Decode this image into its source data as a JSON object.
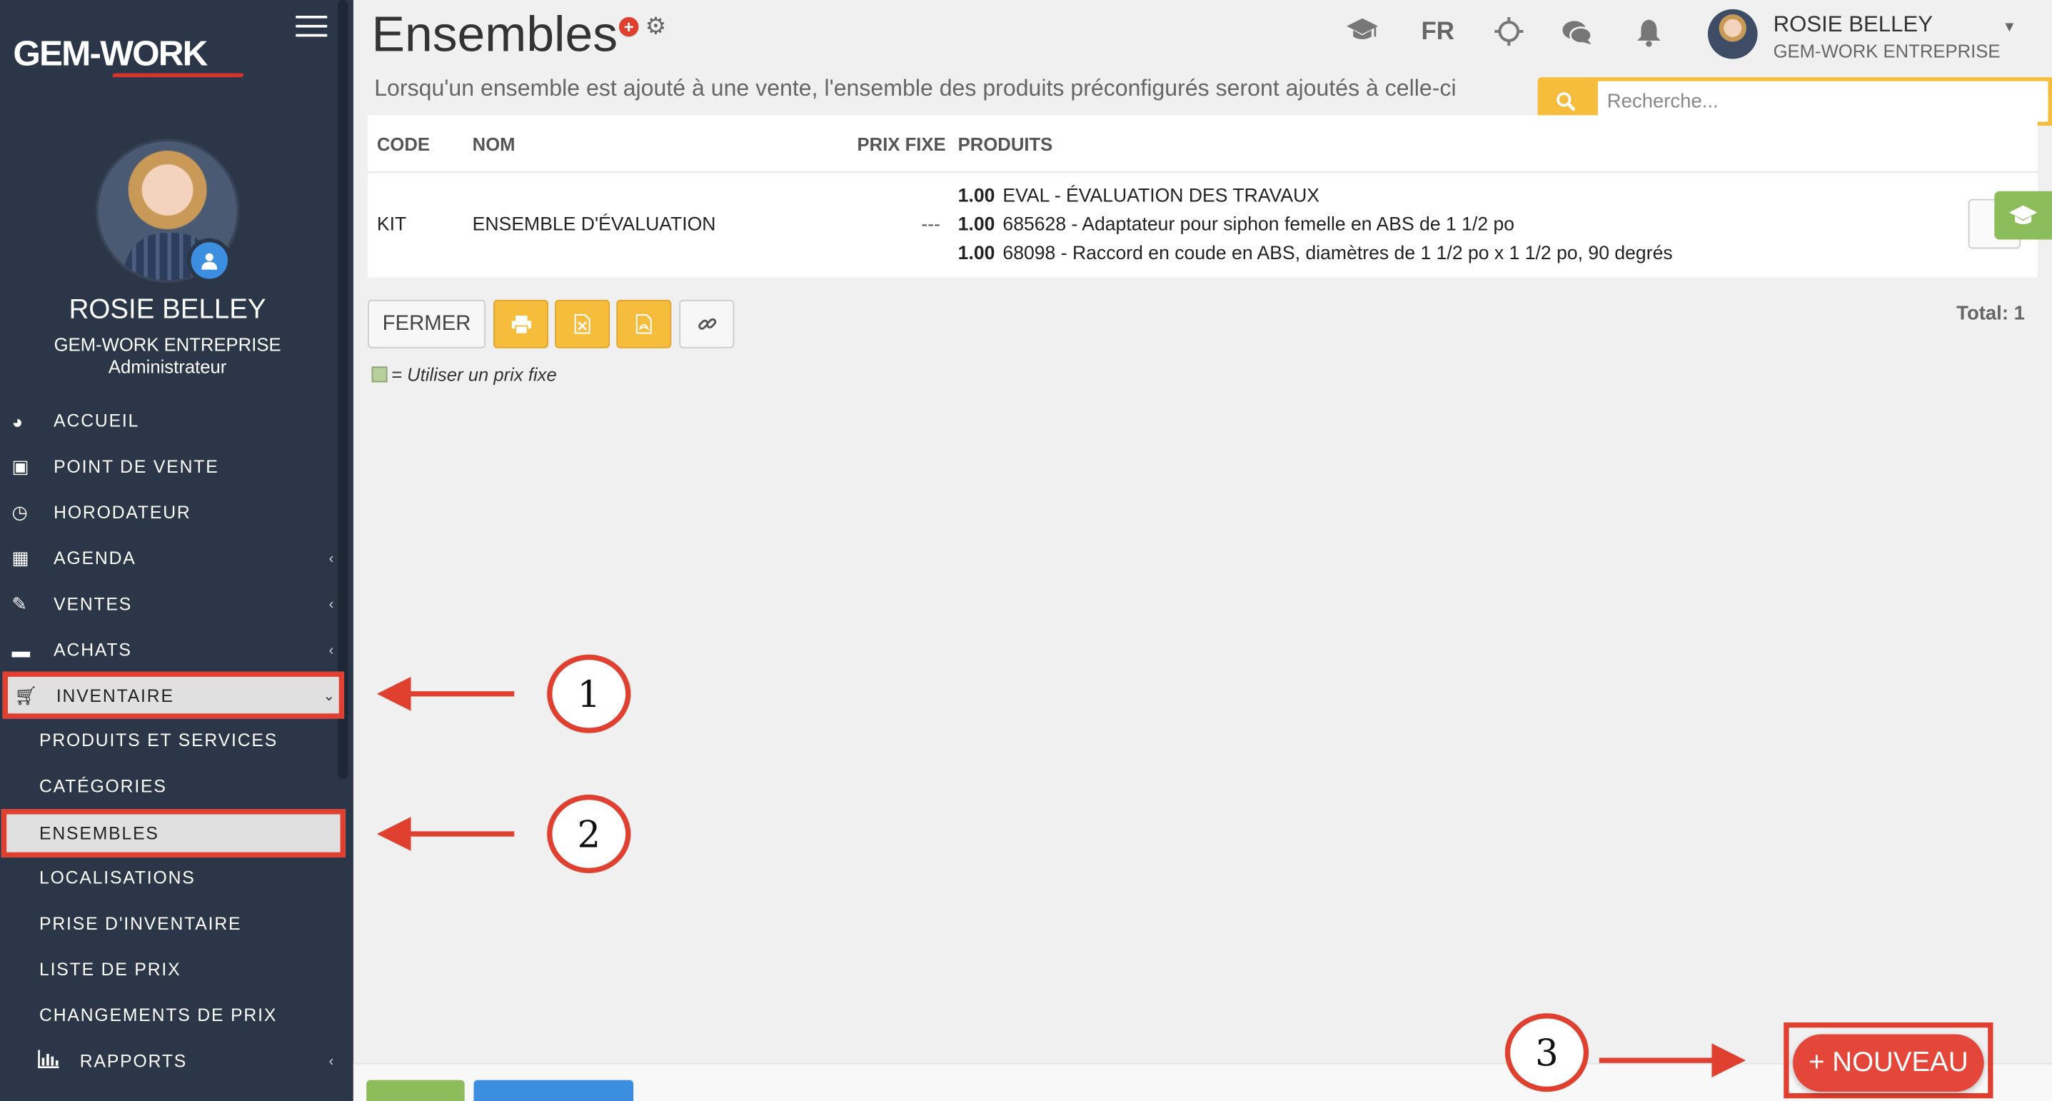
{
  "app": {
    "logo": "GEM-WORK"
  },
  "sidebar": {
    "user_name": "ROSIE BELLEY",
    "company": "GEM-WORK ENTREPRISE",
    "role": "Administrateur",
    "items": [
      {
        "label": "ACCUEIL",
        "icon": "dashboard-icon"
      },
      {
        "label": "POINT DE VENTE",
        "icon": "cash-icon"
      },
      {
        "label": "HORODATEUR",
        "icon": "clock-icon"
      },
      {
        "label": "AGENDA",
        "icon": "calendar-icon"
      },
      {
        "label": "VENTES",
        "icon": "edit-icon"
      },
      {
        "label": "ACHATS",
        "icon": "credit-card-icon"
      },
      {
        "label": "INVENTAIRE",
        "icon": "cart-icon"
      },
      {
        "label": "PRODUITS ET SERVICES"
      },
      {
        "label": "CATÉGORIES"
      },
      {
        "label": "ENSEMBLES"
      },
      {
        "label": "LOCALISATIONS"
      },
      {
        "label": "PRISE D'INVENTAIRE"
      },
      {
        "label": "LISTE DE PRIX"
      },
      {
        "label": "CHANGEMENTS DE PRIX"
      },
      {
        "label": "RAPPORTS",
        "icon": "bar-chart-icon"
      }
    ]
  },
  "header": {
    "title": "Ensembles",
    "subtitle": "Lorsqu'un ensemble est ajouté à une vente, l'ensemble des produits préconfigurés seront ajoutés à celle-ci",
    "language": "FR",
    "user_name": "ROSIE BELLEY",
    "user_company": "GEM-WORK ENTREPRISE"
  },
  "search": {
    "placeholder": "Recherche...",
    "value": ""
  },
  "table": {
    "columns": [
      "CODE",
      "NOM",
      "PRIX FIXE",
      "PRODUITS"
    ],
    "rows": [
      {
        "code": "KIT",
        "name": "ENSEMBLE D'ÉVALUATION",
        "fixed_price": "---",
        "products": [
          {
            "qty": "1.00",
            "desc": "EVAL - ÉVALUATION DES TRAVAUX"
          },
          {
            "qty": "1.00",
            "desc": "685628 - Adaptateur pour siphon femelle en ABS de 1 1/2 po"
          },
          {
            "qty": "1.00",
            "desc": "68098 - Raccord en coude en ABS, diamètres de 1 1/2 po x 1 1/2 po, 90 degrés"
          }
        ]
      }
    ]
  },
  "toolbar": {
    "close_label": "FERMER",
    "total_label": "Total: 1"
  },
  "legend": {
    "text": "= Utiliser un prix fixe"
  },
  "new_button": {
    "label": "+ NOUVEAU"
  },
  "annotations": {
    "step1": "1",
    "step2": "2",
    "step3": "3"
  },
  "colors": {
    "sidebar_bg": "#2c3649",
    "accent_yellow": "#f6bd3d",
    "annotation_red": "#e0402f",
    "fixed_price_green": "#b7cf9a"
  }
}
